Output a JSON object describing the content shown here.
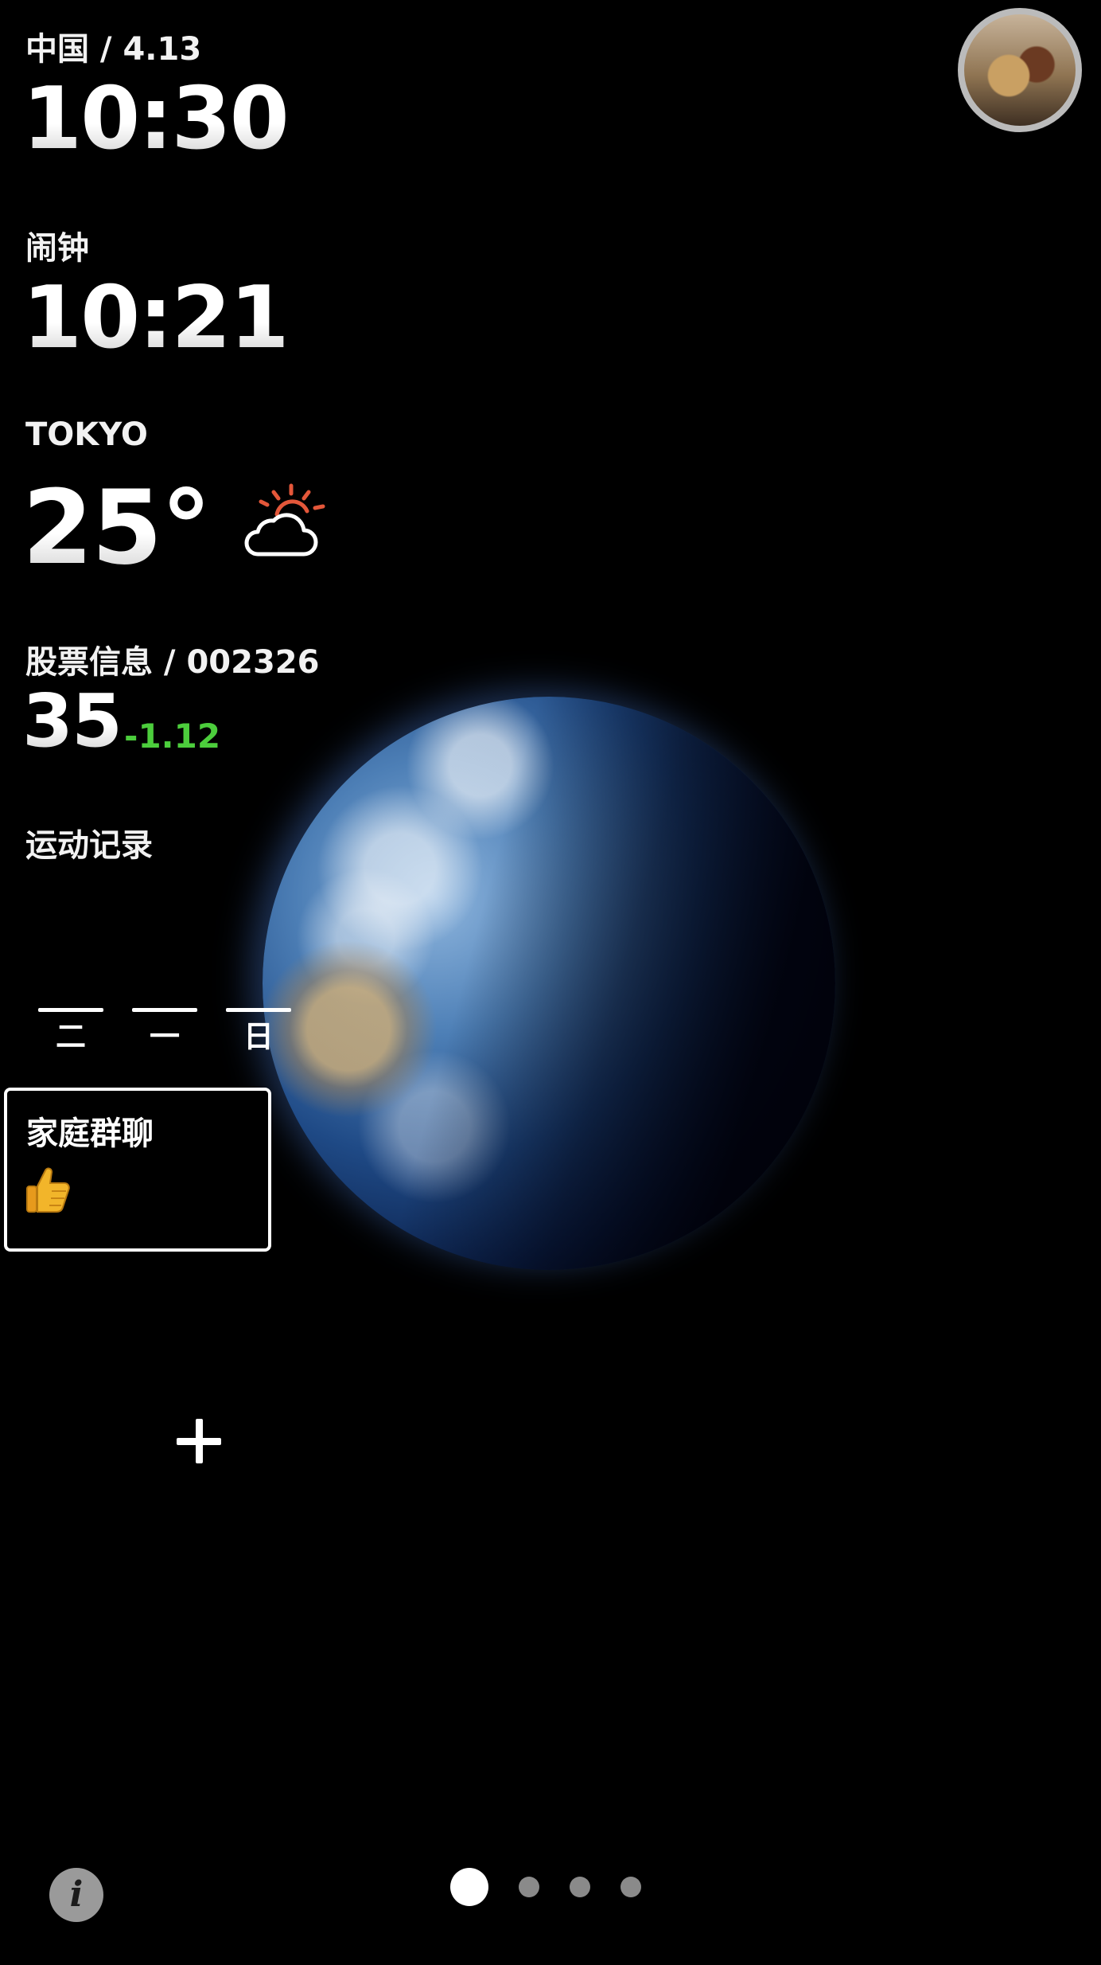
{
  "clock": {
    "location_date": "中国 / 4.13",
    "time": "10:30"
  },
  "alarm": {
    "label": "闹钟",
    "time": "10:21"
  },
  "weather": {
    "city": "TOKYO",
    "temperature": "25°",
    "icon": "partly-cloudy-sun-icon",
    "sun_color": "#e4573a"
  },
  "stock": {
    "label": "股票信息 / 002326",
    "price": "35",
    "change": "-1.12",
    "change_color": "#4ccd3c"
  },
  "exercise": {
    "label": "运动记录",
    "days": [
      {
        "label": "二"
      },
      {
        "label": "一"
      },
      {
        "label": "日"
      }
    ]
  },
  "family_chat": {
    "title": "家庭群聊",
    "emoji": "thumbs-up-icon"
  },
  "controls": {
    "add": "plus-icon",
    "info": "i"
  },
  "pager": {
    "count": 4,
    "active_index": 0
  },
  "avatar": {
    "icon": "avatar"
  }
}
